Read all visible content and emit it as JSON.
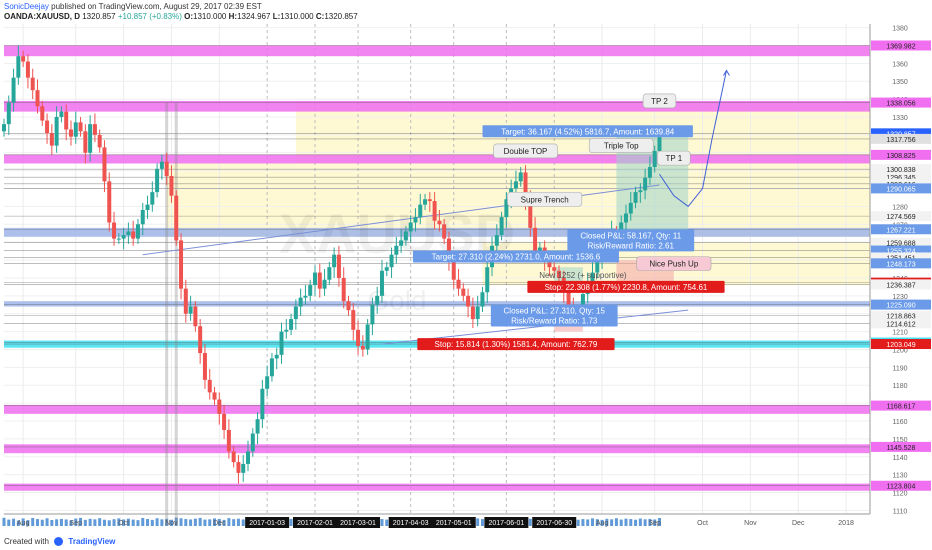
{
  "header": {
    "user": "SonicDeejay",
    "published": "published on TradingView.com, August 29, 2017 02:39 EST",
    "symbol": "OANDA:XAUUSD, D",
    "price": "1320.857",
    "change": "+10.857 (+0.83%)",
    "o_label": "O:",
    "o": "1310.000",
    "h_label": "H:",
    "h": "1324.967",
    "l_label": "L:",
    "l": "1310.000",
    "c_label": "C:",
    "c": "1320.857"
  },
  "footer": {
    "made_with": "Created with",
    "brand": "TradingView"
  },
  "colors": {
    "up": "#26a69a",
    "down": "#ef5350",
    "magenta_zone": "#f06ef0",
    "blue_zone": "#9fb5e8",
    "cyan_zone": "#40e0f0",
    "yellow_zone": "#fff8c8",
    "volume": "#1e6fc8",
    "label_blue": "#6b9be8",
    "label_red": "#e21b1b"
  },
  "chart_data": {
    "type": "candlestick",
    "symbol": "XAUUSD",
    "watermark": "XAUUSD",
    "watermark_sub": "Gold",
    "ylim": [
      1108,
      1382
    ],
    "xlim": [
      0,
      181
    ],
    "y_ticks": [
      1110,
      1120,
      1130,
      1140,
      1150,
      1160,
      1170,
      1180,
      1190,
      1200,
      1210,
      1220,
      1230,
      1240,
      1250,
      1260,
      1270,
      1280,
      1290,
      1300,
      1310,
      1320,
      1330,
      1340,
      1350,
      1360,
      1370,
      1380
    ],
    "x_ticks": [
      {
        "i": 4,
        "label": "Aug",
        "highlight": false
      },
      {
        "i": 15,
        "label": "Sep",
        "highlight": false
      },
      {
        "i": 25,
        "label": "Oct",
        "highlight": false
      },
      {
        "i": 35,
        "label": "Nov",
        "highlight": false
      },
      {
        "i": 45,
        "label": "Dec",
        "highlight": false
      },
      {
        "i": 55,
        "label": "2017-01-03",
        "highlight": true
      },
      {
        "i": 65,
        "label": "2017-02-01",
        "highlight": true
      },
      {
        "i": 74,
        "label": "2017-03-01",
        "highlight": true
      },
      {
        "i": 85,
        "label": "2017-04-03",
        "highlight": true
      },
      {
        "i": 94,
        "label": "2017-05-01",
        "highlight": true
      },
      {
        "i": 105,
        "label": "2017-06-01",
        "highlight": true
      },
      {
        "i": 115,
        "label": "2017-06-30",
        "highlight": true
      },
      {
        "i": 125,
        "label": "Aug",
        "highlight": false
      },
      {
        "i": 136,
        "label": "Sep",
        "highlight": false
      },
      {
        "i": 146,
        "label": "Oct",
        "highlight": false
      },
      {
        "i": 156,
        "label": "Nov",
        "highlight": false
      },
      {
        "i": 166,
        "label": "Dec",
        "highlight": false
      },
      {
        "i": 176,
        "label": "2018",
        "highlight": false
      }
    ],
    "price_levels": [
      {
        "value": 1369.982,
        "label": "1369.982",
        "style": "magenta"
      },
      {
        "value": 1338.056,
        "label": "1338.056",
        "style": "magenta"
      },
      {
        "value": 1320.857,
        "label": "1320.857",
        "style": "current"
      },
      {
        "value": 1317.756,
        "label": "1317.756",
        "style": "gray"
      },
      {
        "value": 1308.825,
        "label": "1308.825",
        "style": "magenta"
      },
      {
        "value": 1300.838,
        "label": "1300.838",
        "style": "white"
      },
      {
        "value": 1296.345,
        "label": "1296.345",
        "style": "white"
      },
      {
        "value": 1292.616,
        "label": "1292.616",
        "style": "white"
      },
      {
        "value": 1290.065,
        "label": "1290.065",
        "style": "blue"
      },
      {
        "value": 1274.569,
        "label": "1274.569",
        "style": "white"
      },
      {
        "value": 1267.221,
        "label": "1267.221",
        "style": "blue"
      },
      {
        "value": 1259.688,
        "label": "1259.688",
        "style": "white"
      },
      {
        "value": 1255.324,
        "label": "1255.324",
        "style": "blue"
      },
      {
        "value": 1251.451,
        "label": "1251.451",
        "style": "white"
      },
      {
        "value": 1248.173,
        "label": "1248.173",
        "style": "blue"
      },
      {
        "value": 1237.38,
        "label": "1237.380",
        "style": "red"
      },
      {
        "value": 1236.387,
        "label": "1236.387",
        "style": "white"
      },
      {
        "value": 1225.09,
        "label": "1225.090",
        "style": "blue"
      },
      {
        "value": 1218.863,
        "label": "1218.863",
        "style": "white"
      },
      {
        "value": 1214.612,
        "label": "1214.612",
        "style": "white"
      },
      {
        "value": 1203.873,
        "label": "1203.873",
        "style": "cyan"
      },
      {
        "value": 1203.049,
        "label": "1203.049",
        "style": "red"
      },
      {
        "value": 1168.617,
        "label": "1168.617",
        "style": "magenta"
      },
      {
        "value": 1145.528,
        "label": "1145.528",
        "style": "magenta"
      },
      {
        "value": 1123.804,
        "label": "1123.804",
        "style": "magenta"
      }
    ],
    "zones": [
      {
        "y1": 1364,
        "y2": 1370,
        "color": "magenta"
      },
      {
        "y1": 1333,
        "y2": 1339,
        "color": "magenta"
      },
      {
        "y1": 1304,
        "y2": 1309,
        "color": "magenta"
      },
      {
        "y1": 1263,
        "y2": 1268,
        "color": "blue"
      },
      {
        "y1": 1224,
        "y2": 1227,
        "color": "blue"
      },
      {
        "y1": 1201,
        "y2": 1205,
        "color": "cyan"
      },
      {
        "y1": 1164,
        "y2": 1169,
        "color": "magenta"
      },
      {
        "y1": 1142,
        "y2": 1147,
        "color": "magenta"
      },
      {
        "y1": 1121,
        "y2": 1125,
        "color": "magenta"
      }
    ],
    "yellow_boxes": [
      {
        "x1": 61,
        "x2": 181,
        "y1": 1304,
        "y2": 1338
      },
      {
        "x1": 34,
        "x2": 181,
        "y1": 1263,
        "y2": 1304
      },
      {
        "x1": 100,
        "x2": 181,
        "y1": 1236,
        "y2": 1260
      }
    ],
    "annotations": [
      {
        "text": "Double TOP",
        "i": 109,
        "y": 1311,
        "kind": "callout"
      },
      {
        "text": "Supre Trench",
        "i": 113,
        "y": 1284,
        "kind": "callout"
      },
      {
        "text": "Triple Top",
        "i": 129,
        "y": 1314,
        "kind": "callout"
      },
      {
        "text": "TP 2",
        "i": 137,
        "y": 1339,
        "kind": "callout"
      },
      {
        "text": "TP 1",
        "i": 140,
        "y": 1307,
        "kind": "callout"
      },
      {
        "text": "Nice Push Up",
        "i": 140,
        "y": 1248,
        "kind": "pink"
      },
      {
        "text": "New 1252 (+ supportive)",
        "i": 121,
        "y": 1240,
        "kind": "faint"
      }
    ],
    "trade_labels": [
      {
        "lines": [
          "Target: 36.167 (4.52%) 5816.7, Amount: 1639.84"
        ],
        "i": 122,
        "y": 1322,
        "kind": "blue"
      },
      {
        "lines": [
          "Closed P&L: 58.167, Qty: 11",
          "Risk/Reward Ratio: 2.61"
        ],
        "i": 131,
        "y": 1261,
        "kind": "blue"
      },
      {
        "lines": [
          "Target: 27.310 (2.24%) 2731.0, Amount: 1536.6"
        ],
        "i": 107,
        "y": 1252,
        "kind": "blue"
      },
      {
        "lines": [
          "Stop: 22.308 (1.77%) 2230.8, Amount: 754.61"
        ],
        "i": 130,
        "y": 1235,
        "kind": "red"
      },
      {
        "lines": [
          "Closed P&L: 27.310, Qty: 15",
          "Risk/Reward Ratio: 1.73"
        ],
        "i": 115,
        "y": 1219,
        "kind": "blue"
      },
      {
        "lines": [
          "Stop: 15.814 (1.30%) 1581.4, Amount: 762.79"
        ],
        "i": 107,
        "y": 1203,
        "kind": "red"
      }
    ],
    "trendlines": [
      {
        "x1": 29,
        "y1": 1253,
        "x2": 137,
        "y2": 1292
      },
      {
        "x1": 79,
        "y1": 1203,
        "x2": 143,
        "y2": 1222
      }
    ],
    "projection": [
      [
        137,
        1298
      ],
      [
        140,
        1286
      ],
      [
        143,
        1280
      ],
      [
        146,
        1290
      ],
      [
        148,
        1318
      ],
      [
        151,
        1356
      ]
    ],
    "trade_boxes": [
      {
        "x1": 128,
        "x2": 143,
        "y1": 1298,
        "y2": 1322,
        "color": "green"
      },
      {
        "x1": 128,
        "x2": 143,
        "y1": 1266,
        "y2": 1298,
        "color": "green"
      },
      {
        "x1": 128,
        "x2": 140,
        "y1": 1238,
        "y2": 1250,
        "color": "red"
      },
      {
        "x1": 115,
        "x2": 121,
        "y1": 1236,
        "y2": 1246,
        "color": "green"
      },
      {
        "x1": 115,
        "x2": 121,
        "y1": 1210,
        "y2": 1222,
        "color": "red"
      }
    ],
    "closes": [
      1326,
      1338,
      1352,
      1364,
      1361,
      1352,
      1345,
      1336,
      1328,
      1321,
      1314,
      1330,
      1333,
      1323,
      1319,
      1327,
      1322,
      1310,
      1326,
      1320,
      1313,
      1294,
      1271,
      1262,
      1262,
      1264,
      1266,
      1262,
      1270,
      1278,
      1281,
      1288,
      1301,
      1305,
      1297,
      1286,
      1261,
      1234,
      1220,
      1224,
      1213,
      1198,
      1183,
      1176,
      1172,
      1164,
      1155,
      1143,
      1137,
      1131,
      1136,
      1143,
      1153,
      1161,
      1178,
      1185,
      1195,
      1197,
      1210,
      1211,
      1217,
      1224,
      1229,
      1230,
      1236,
      1243,
      1234,
      1239,
      1246,
      1253,
      1240,
      1227,
      1222,
      1211,
      1202,
      1200,
      1214,
      1225,
      1230,
      1244,
      1246,
      1253,
      1258,
      1261,
      1266,
      1271,
      1274,
      1281,
      1284,
      1283,
      1272,
      1270,
      1262,
      1250,
      1239,
      1234,
      1230,
      1224,
      1217,
      1224,
      1232,
      1246,
      1258,
      1264,
      1274,
      1284,
      1290,
      1294,
      1299,
      1284,
      1268,
      1255,
      1257,
      1250,
      1246,
      1244,
      1240,
      1232,
      1223,
      1219,
      1222,
      1231,
      1238,
      1243,
      1251,
      1255,
      1260,
      1266,
      1264,
      1271,
      1276,
      1282,
      1288,
      1289,
      1296,
      1302,
      1311,
      1320
    ],
    "volumes": [
      62,
      48,
      55,
      41,
      57,
      44,
      60,
      52,
      47,
      58,
      45,
      50,
      53,
      49,
      42,
      56,
      61,
      46,
      54,
      50,
      59,
      47,
      43,
      51,
      57,
      49,
      55,
      48,
      44,
      60,
      52,
      46,
      58,
      50,
      54,
      47,
      63,
      58,
      52,
      49,
      55,
      61,
      48,
      50,
      57,
      53,
      46,
      59,
      51,
      55,
      49,
      44,
      52,
      47,
      58,
      50,
      54,
      46,
      61,
      48,
      53,
      57,
      45,
      50,
      55,
      49,
      62,
      48,
      53,
      47,
      58,
      51,
      46,
      55,
      50,
      57,
      49,
      44,
      56,
      52,
      48,
      60,
      50,
      55,
      47,
      53,
      49,
      58,
      51,
      46,
      57,
      52,
      48,
      55,
      61,
      50,
      46,
      54,
      49,
      57,
      52,
      48,
      59,
      53,
      47,
      55,
      50,
      46,
      58,
      51,
      54,
      49,
      62,
      47,
      53,
      50,
      56,
      48,
      55,
      59,
      47,
      52,
      49,
      57,
      51,
      46,
      54,
      50,
      58,
      48,
      55,
      52,
      47,
      56,
      50,
      53,
      49,
      60
    ],
    "volume_spikes": [
      {
        "i": 34,
        "v": 230
      },
      {
        "i": 36,
        "v": 110
      }
    ]
  }
}
